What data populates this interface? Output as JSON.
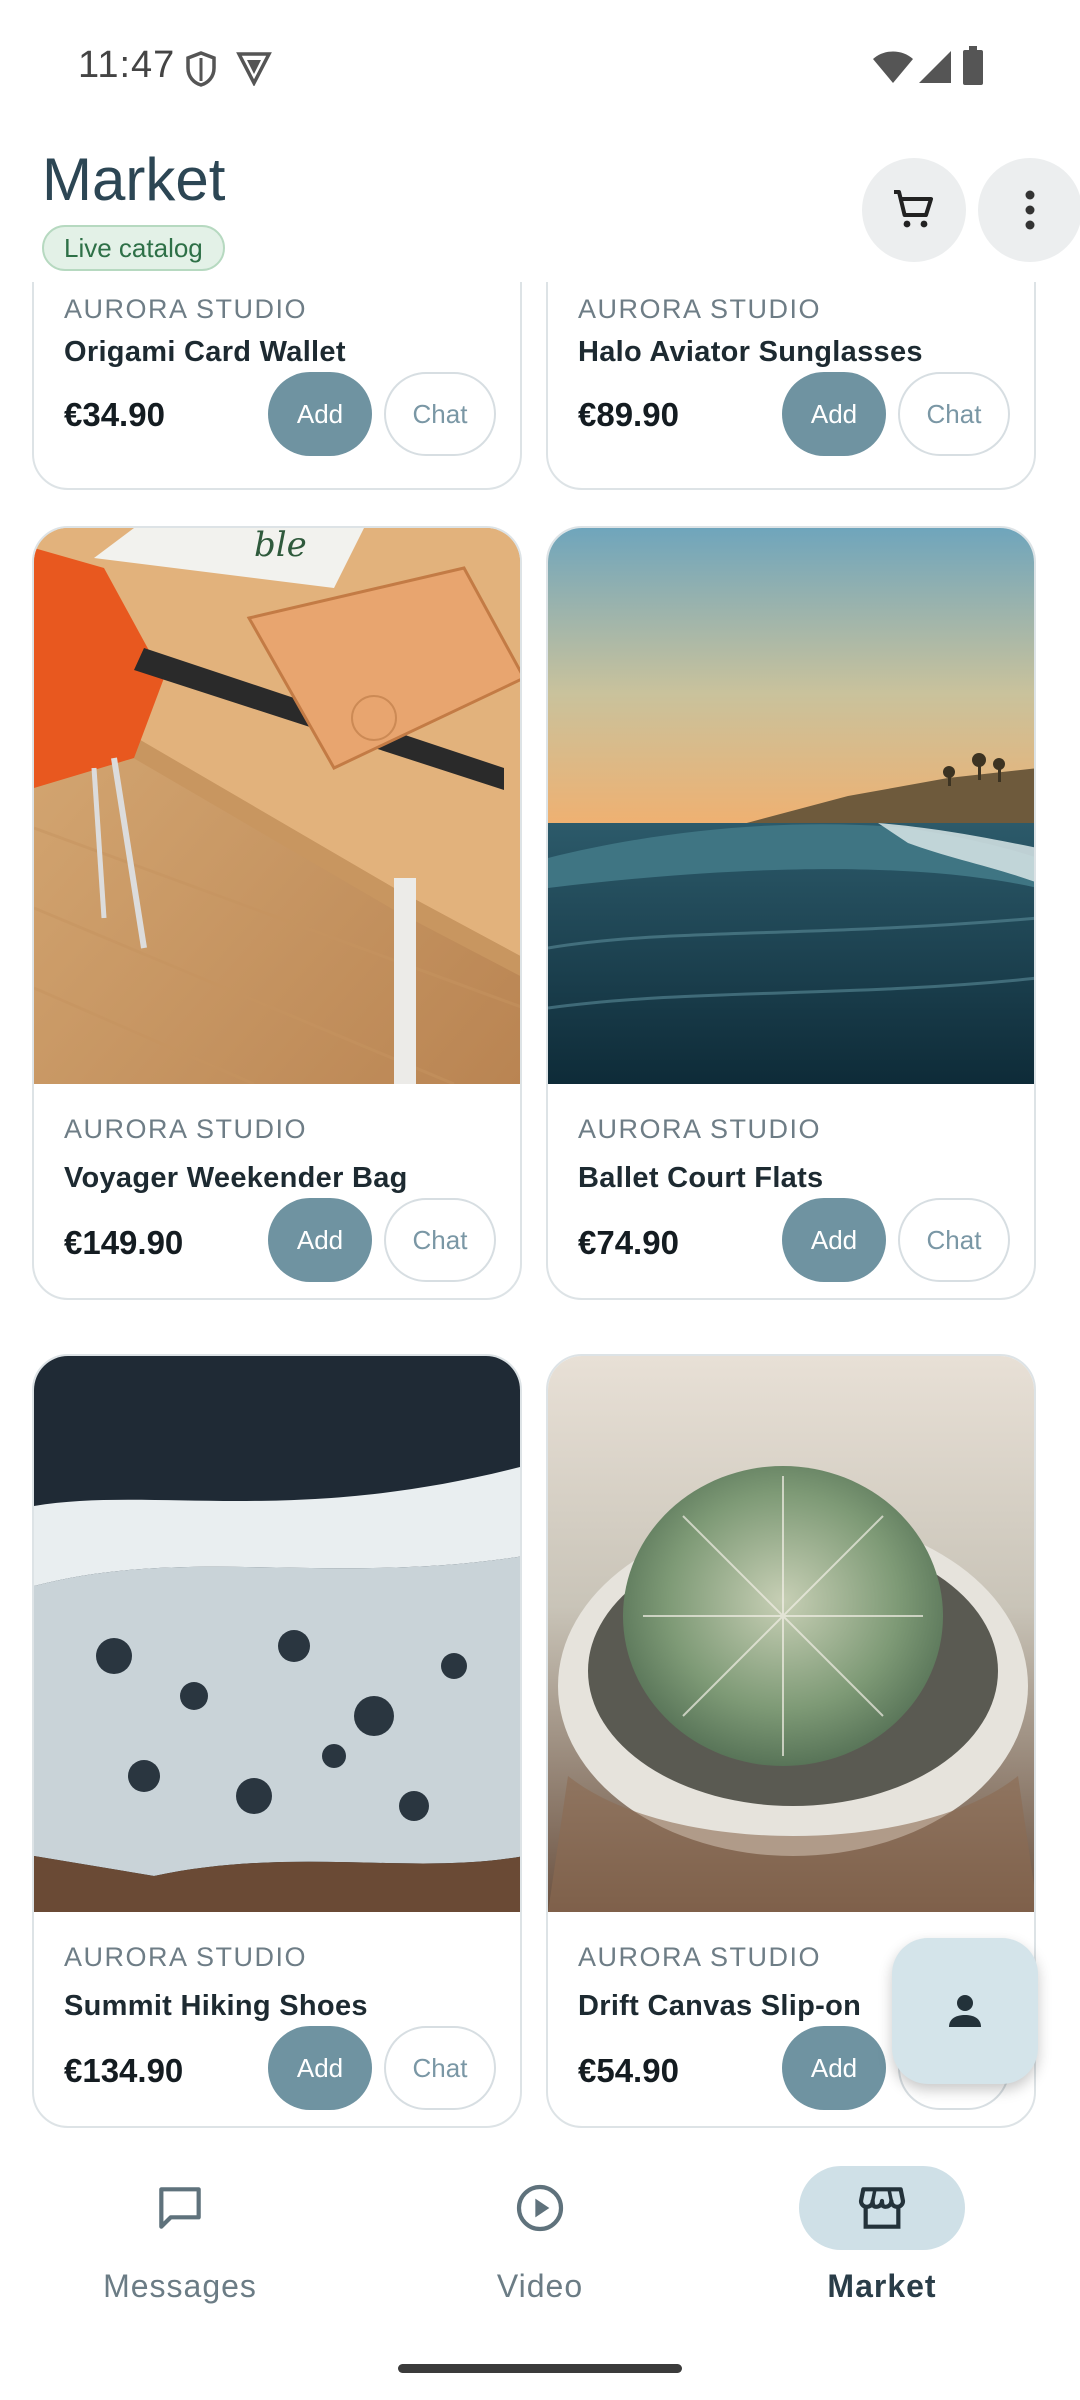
{
  "status_bar": {
    "time": "11:47"
  },
  "header": {
    "title": "Market",
    "chip": "Live catalog"
  },
  "products": [
    {
      "brand": "AURORA STUDIO",
      "name": "Origami Card Wallet",
      "price": "€34.90",
      "add": "Add",
      "chat": "Chat"
    },
    {
      "brand": "AURORA STUDIO",
      "name": "Halo Aviator Sunglasses",
      "price": "€89.90",
      "add": "Add",
      "chat": "Chat"
    },
    {
      "brand": "AURORA STUDIO",
      "name": "Voyager Weekender Bag",
      "price": "€149.90",
      "add": "Add",
      "chat": "Chat",
      "photo": "desk-with-notebook"
    },
    {
      "brand": "AURORA STUDIO",
      "name": "Ballet Court Flats",
      "price": "€74.90",
      "add": "Add",
      "chat": "Chat",
      "photo": "ocean-wave-sunset"
    },
    {
      "brand": "AURORA STUDIO",
      "name": "Summit Hiking Shoes",
      "price": "€134.90",
      "add": "Add",
      "chat": "Chat",
      "photo": "sea-foam-shore"
    },
    {
      "brand": "AURORA STUDIO",
      "name": "Drift Canvas Slip-on",
      "price": "€54.90",
      "add": "Add",
      "chat": "Chat",
      "photo": "potted-cactus"
    }
  ],
  "fab": {
    "icon": "person-icon"
  },
  "bottom_nav": {
    "items": [
      {
        "label": "Messages",
        "icon": "chat-bubble-icon"
      },
      {
        "label": "Video",
        "icon": "play-circle-icon"
      },
      {
        "label": "Market",
        "icon": "storefront-icon",
        "active": true
      }
    ]
  },
  "colors": {
    "accent": "#6f93a1",
    "chip_text": "#2e7047",
    "nav_active_bg": "#cfe0e7"
  }
}
